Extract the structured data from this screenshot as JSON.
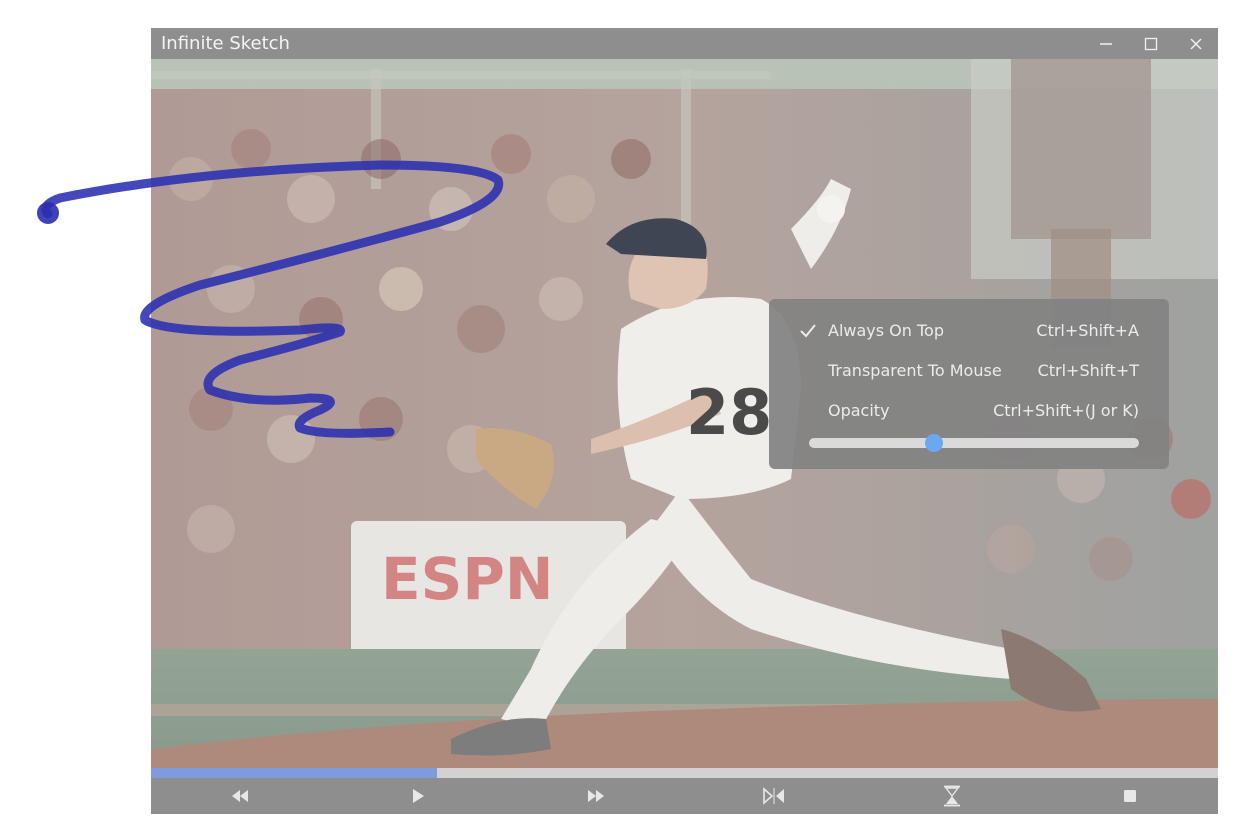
{
  "window": {
    "title": "Infinite Sketch"
  },
  "titlebar_icons": {
    "minimize": "minimize-icon",
    "maximize": "maximize-icon",
    "close": "close-icon"
  },
  "canvas": {
    "image": "baseball-pitcher-photo",
    "ink_color": "#2a2fb0",
    "jersey_number": "28"
  },
  "progress": {
    "fraction": 0.268,
    "fill_color": "#7f9be0"
  },
  "playback": {
    "buttons": [
      {
        "name": "rewind-button",
        "icon": "rewind-icon"
      },
      {
        "name": "play-button",
        "icon": "play-icon"
      },
      {
        "name": "fast-forward-button",
        "icon": "fast-forward-icon"
      },
      {
        "name": "flip-button",
        "icon": "flip-horizontal-icon"
      },
      {
        "name": "hourglass-button",
        "icon": "hourglass-icon"
      },
      {
        "name": "stop-button",
        "icon": "stop-icon"
      }
    ]
  },
  "context_menu": {
    "items": [
      {
        "label": "Always On Top",
        "shortcut": "Ctrl+Shift+A",
        "checked": true
      },
      {
        "label": "Transparent To Mouse",
        "shortcut": "Ctrl+Shift+T",
        "checked": false
      },
      {
        "label": "Opacity",
        "shortcut": "Ctrl+Shift+(J or K)",
        "checked": false
      }
    ],
    "opacity_value": 0.38,
    "accent": "#6aa9f2"
  }
}
